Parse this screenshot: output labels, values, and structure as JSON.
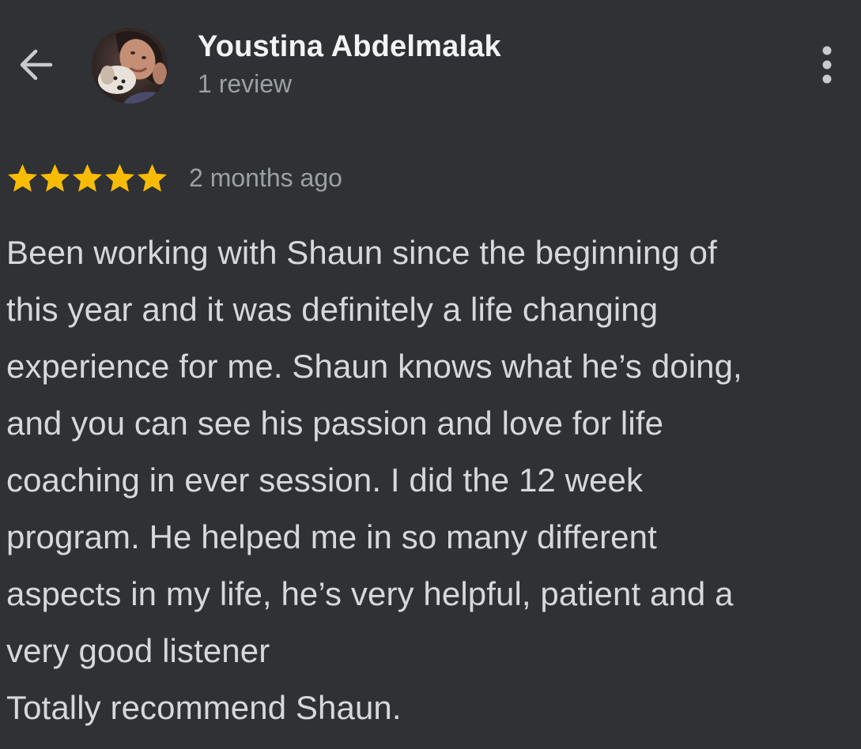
{
  "header": {
    "back_icon": "arrow-back-icon",
    "reviewer_name": "Youstina Abdelmalak",
    "review_count": "1 review",
    "avatar_alt": "Youstina Abdelmalak profile photo",
    "more_icon": "more-vertical-icon"
  },
  "review": {
    "rating": 5,
    "max_rating": 5,
    "star_color": "#f9bc05",
    "date": "2 months ago",
    "body": "Been working with Shaun since the beginning of\nthis year and it was definitely a life changing\nexperience for me. Shaun knows what he’s doing,\nand you can see his passion and love for life\ncoaching in ever session. I did the 12 week\nprogram. He helped me in so many different\naspects in my life, he’s very helpful, patient and a\nvery good listener\nTotally recommend Shaun."
  },
  "colors": {
    "background": "#303134",
    "primary_text": "#f1f3f4",
    "secondary_text": "#9aa0a6",
    "body_text": "#d6d8db"
  }
}
